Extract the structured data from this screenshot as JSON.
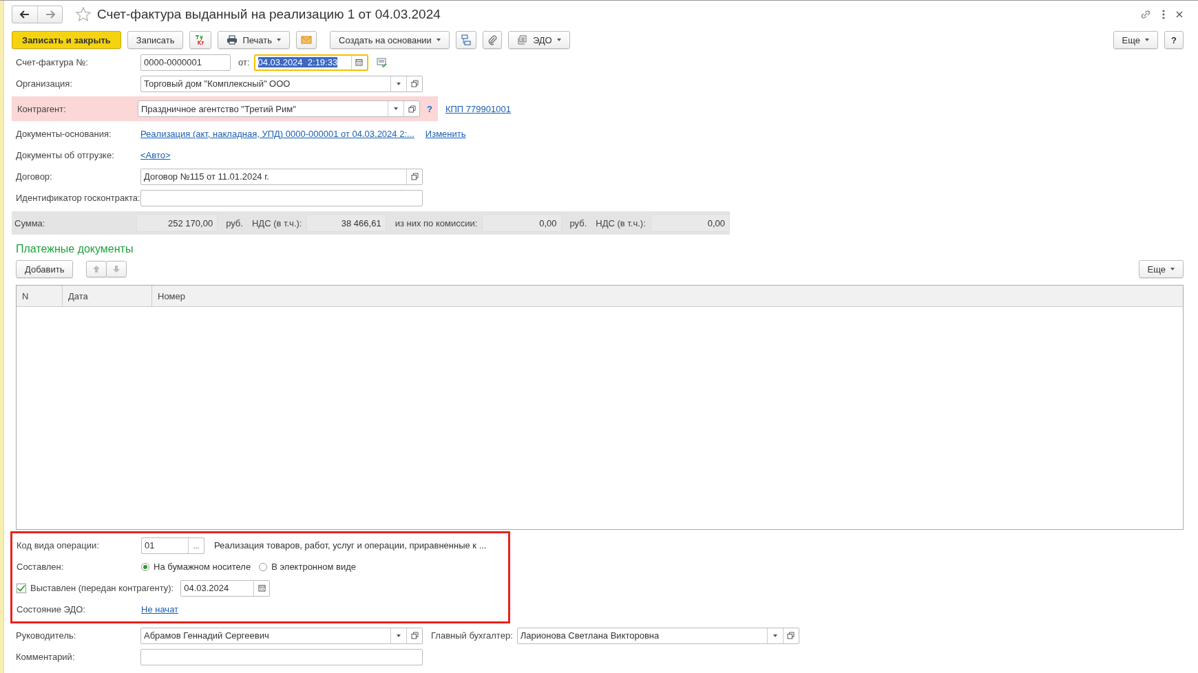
{
  "window": {
    "title": "Счет-фактура выданный на реализацию 1 от 04.03.2024",
    "favorite": false
  },
  "toolbar": {
    "save_close": "Записать и закрыть",
    "save": "Записать",
    "print": "Печать",
    "create_based": "Создать на основании",
    "edo": "ЭДО",
    "more": "Еще",
    "help": "?"
  },
  "invoice": {
    "label": "Счет-фактура №:",
    "number": "0000-0000001",
    "date_label": "от:",
    "date": "04.03.2024  2:19:33",
    "date_selected": true
  },
  "organization": {
    "label": "Организация:",
    "value": "Торговый дом \"Комплексный\" ООО"
  },
  "counterparty": {
    "label": "Контрагент:",
    "value": "Праздничное агентство \"Третий Рим\"",
    "error": true,
    "help": "?",
    "kpp": "КПП 779901001"
  },
  "base_docs": {
    "label": "Документы-основания:",
    "link": "Реализация (акт, накладная, УПД) 0000-000001 от 04.03.2024 2:...",
    "change": "Изменить"
  },
  "shipping_docs": {
    "label": "Документы об отгрузке:",
    "link": "<Авто>"
  },
  "contract": {
    "label": "Договор:",
    "value": "Договор №115 от 11.01.2024 г."
  },
  "gov_contract": {
    "label": "Идентификатор госконтракта:"
  },
  "totals": [
    {
      "label": "Сумма:",
      "value": "252 170,00",
      "unit": "руб."
    },
    {
      "label": "НДС (в т.ч.):",
      "value": "38 466,61"
    },
    {
      "label": "из них по комиссии:",
      "value": "0,00",
      "unit": "руб."
    },
    {
      "label": "НДС (в т.ч.):",
      "value": "0,00"
    }
  ],
  "payments": {
    "title": "Платежные документы",
    "add": "Добавить",
    "more": "Еще",
    "columns": [
      "N",
      "Дата",
      "Номер"
    ]
  },
  "highlight": true,
  "operation": {
    "label": "Код вида операции:",
    "code": "01",
    "select": "...",
    "description": "Реализация товаров, работ, услуг и операции, приравненные к ..."
  },
  "composed": {
    "label": "Составлен:",
    "options": [
      {
        "label": "На бумажном носителе",
        "selected": true
      },
      {
        "label": "В электронном виде",
        "selected": false
      }
    ]
  },
  "issued": {
    "label": "Выставлен (передан контрагенту):",
    "checked": true,
    "date": "04.03.2024"
  },
  "edo_state": {
    "label": "Состояние ЭДО:",
    "link": "Не начат"
  },
  "head": {
    "label": "Руководитель:",
    "value": "Абрамов Геннадий Сергеевич"
  },
  "chief_accountant": {
    "label": "Главный бухгалтер:",
    "value": "Ларионова Светлана Викторовна"
  },
  "comment": {
    "label": "Комментарий:"
  }
}
